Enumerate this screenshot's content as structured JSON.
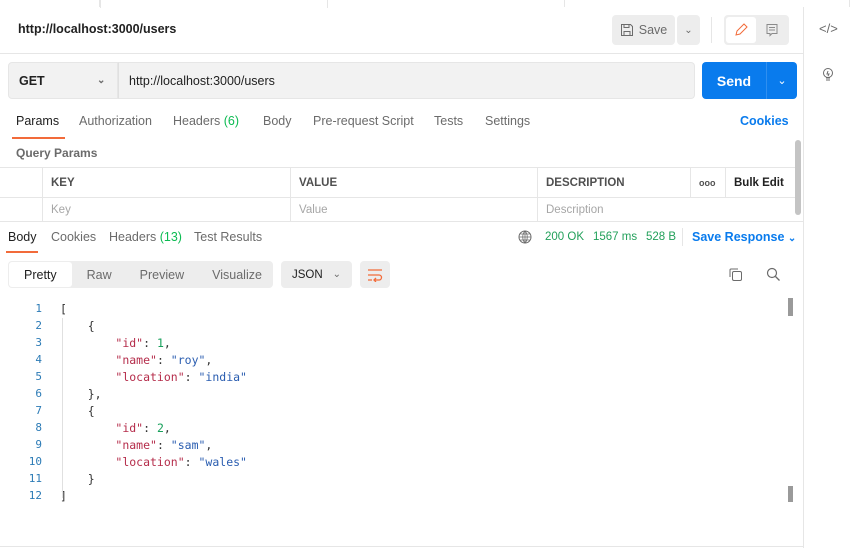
{
  "request": {
    "title": "http://localhost:3000/users",
    "save_label": "Save",
    "method": "GET",
    "url": "http://localhost:3000/users",
    "send_label": "Send"
  },
  "req_tabs": {
    "params": "Params",
    "authorization": "Authorization",
    "headers": "Headers",
    "headers_count": "(6)",
    "body": "Body",
    "prerequest": "Pre-request Script",
    "tests": "Tests",
    "settings": "Settings",
    "cookies": "Cookies"
  },
  "query_params": {
    "title": "Query Params",
    "columns": [
      "KEY",
      "VALUE",
      "DESCRIPTION"
    ],
    "more": "ooo",
    "bulk_edit": "Bulk Edit",
    "placeholders": [
      "Key",
      "Value",
      "Description"
    ]
  },
  "response": {
    "tabs": {
      "body": "Body",
      "cookies": "Cookies",
      "headers": "Headers",
      "headers_count": "(13)",
      "test_results": "Test Results"
    },
    "status": "200 OK",
    "time": "1567 ms",
    "size": "528 B",
    "save_response": "Save Response",
    "views": [
      "Pretty",
      "Raw",
      "Preview",
      "Visualize"
    ],
    "format": "JSON",
    "lines": [
      [
        [
          "p",
          "["
        ]
      ],
      [
        [
          "p",
          "    {"
        ]
      ],
      [
        [
          "p",
          "        "
        ],
        [
          "k",
          "\"id\""
        ],
        [
          "p",
          ": "
        ],
        [
          "n",
          "1"
        ],
        [
          "p",
          ","
        ]
      ],
      [
        [
          "p",
          "        "
        ],
        [
          "k",
          "\"name\""
        ],
        [
          "p",
          ": "
        ],
        [
          "s",
          "\"roy\""
        ],
        [
          "p",
          ","
        ]
      ],
      [
        [
          "p",
          "        "
        ],
        [
          "k",
          "\"location\""
        ],
        [
          "p",
          ": "
        ],
        [
          "s",
          "\"india\""
        ]
      ],
      [
        [
          "p",
          "    },"
        ]
      ],
      [
        [
          "p",
          "    {"
        ]
      ],
      [
        [
          "p",
          "        "
        ],
        [
          "k",
          "\"id\""
        ],
        [
          "p",
          ": "
        ],
        [
          "n",
          "2"
        ],
        [
          "p",
          ","
        ]
      ],
      [
        [
          "p",
          "        "
        ],
        [
          "k",
          "\"name\""
        ],
        [
          "p",
          ": "
        ],
        [
          "s",
          "\"sam\""
        ],
        [
          "p",
          ","
        ]
      ],
      [
        [
          "p",
          "        "
        ],
        [
          "k",
          "\"location\""
        ],
        [
          "p",
          ": "
        ],
        [
          "s",
          "\"wales\""
        ]
      ],
      [
        [
          "p",
          "    }"
        ]
      ],
      [
        [
          "p",
          "]"
        ]
      ]
    ]
  }
}
